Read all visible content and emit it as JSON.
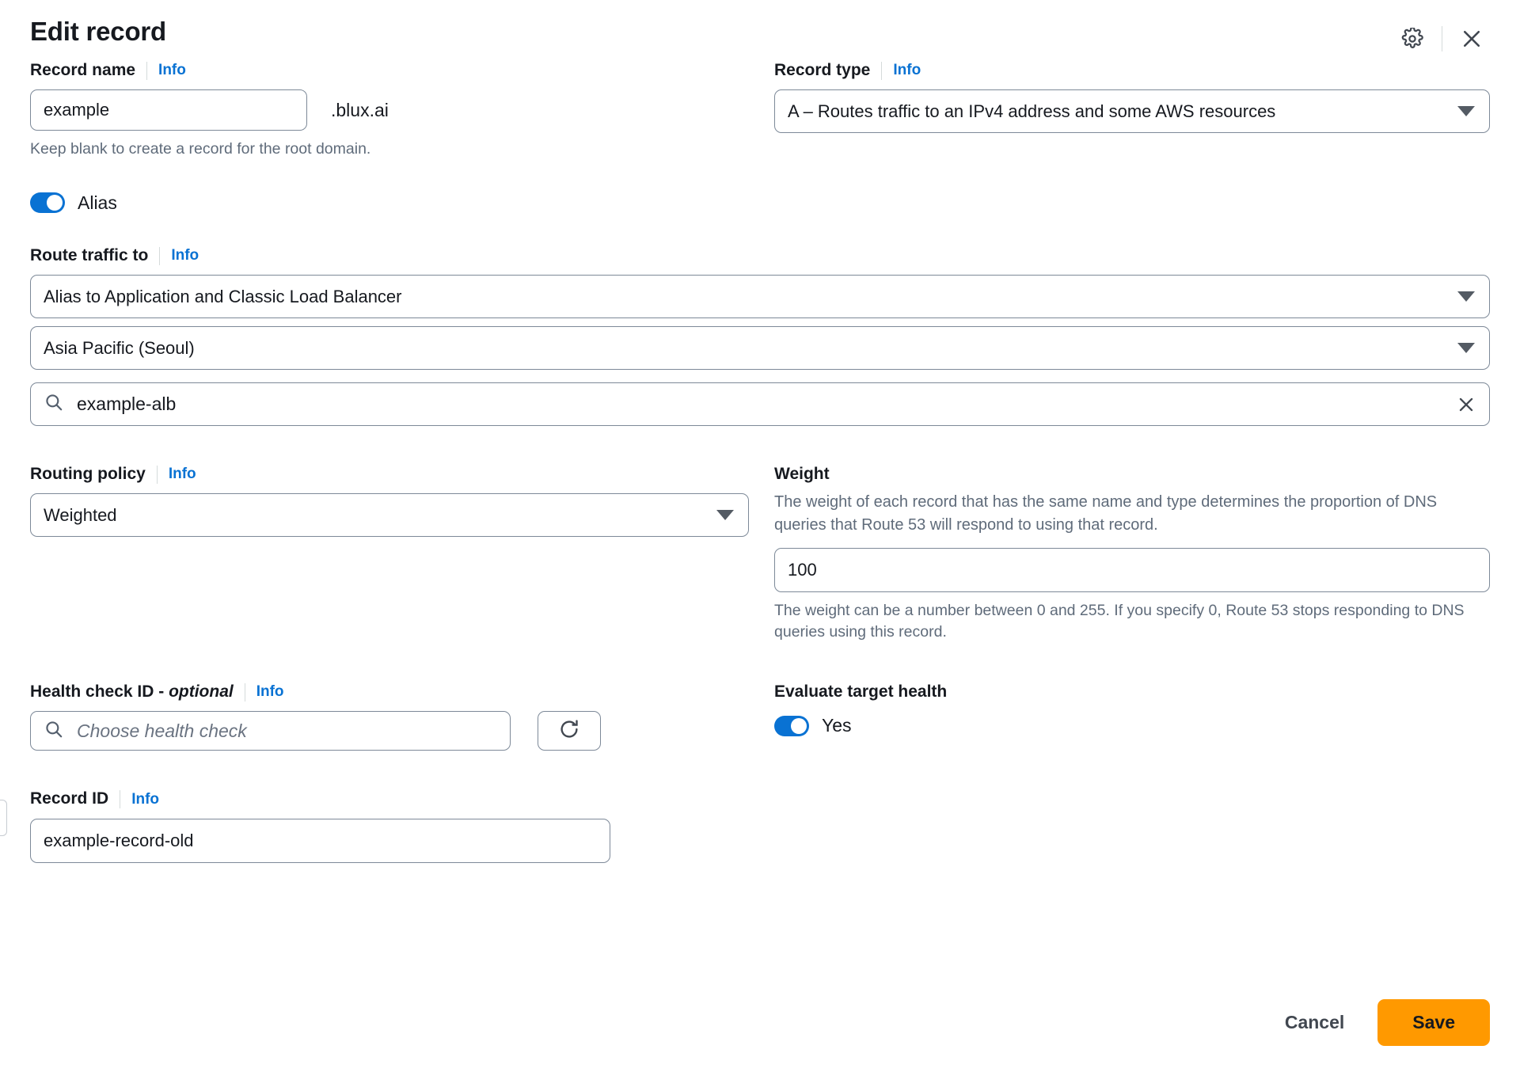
{
  "header": {
    "title": "Edit record",
    "settings_icon": "gear-icon",
    "close_icon": "close-icon"
  },
  "record_name": {
    "label": "Record name",
    "info": "Info",
    "value": "example",
    "domain_suffix": ".blux.ai",
    "hint": "Keep blank to create a record for the root domain."
  },
  "record_type": {
    "label": "Record type",
    "info": "Info",
    "value": "A – Routes traffic to an IPv4 address and some AWS resources"
  },
  "alias": {
    "label": "Alias",
    "enabled": true
  },
  "route_traffic_to": {
    "label": "Route traffic to",
    "info": "Info",
    "target_type": "Alias to Application and Classic Load Balancer",
    "region": "Asia Pacific (Seoul)",
    "resource_search_value": "example-alb",
    "search_icon": "search-icon",
    "clear_icon": "close-icon"
  },
  "routing_policy": {
    "label": "Routing policy",
    "info": "Info",
    "value": "Weighted"
  },
  "weight": {
    "label": "Weight",
    "description": "The weight of each record that has the same name and type determines the proportion of DNS queries that Route 53 will respond to using that record.",
    "value": "100",
    "hint": "The weight can be a number between 0 and 255. If you specify 0, Route 53 stops responding to DNS queries using this record."
  },
  "health_check": {
    "label_main": "Health check ID - ",
    "label_optional": "optional",
    "info": "Info",
    "placeholder": "Choose health check",
    "search_icon": "search-icon",
    "refresh_icon": "refresh-icon"
  },
  "evaluate_target_health": {
    "label": "Evaluate target health",
    "toggle_label": "Yes",
    "enabled": true
  },
  "record_id": {
    "label": "Record ID",
    "info": "Info",
    "value": "example-record-old"
  },
  "footer": {
    "cancel_label": "Cancel",
    "save_label": "Save"
  },
  "colors": {
    "accent_blue": "#0972d3",
    "save_orange": "#ff9900",
    "border_gray": "#7d8998",
    "muted_text": "#5f6b7a"
  }
}
